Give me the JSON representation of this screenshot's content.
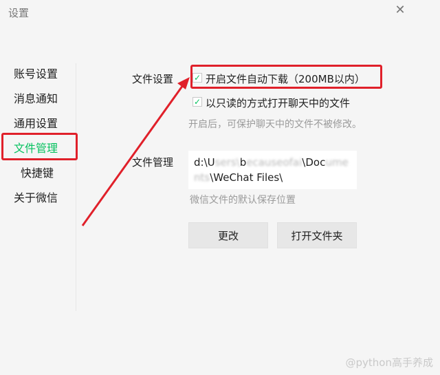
{
  "window": {
    "title": "设置",
    "close_glyph": "✕"
  },
  "sidebar": {
    "items": [
      {
        "label": "账号设置",
        "active": false
      },
      {
        "label": "消息通知",
        "active": false
      },
      {
        "label": "通用设置",
        "active": false
      },
      {
        "label": "文件管理",
        "active": true
      },
      {
        "label": "快捷键",
        "active": false
      },
      {
        "label": "关于微信",
        "active": false
      }
    ]
  },
  "file_settings": {
    "label": "文件设置",
    "auto_download": {
      "label": "开启文件自动下载（200MB以内）",
      "checked": true
    },
    "read_only": {
      "label": "以只读的方式打开聊天中的文件",
      "checked": true
    },
    "hint": "开启后，可保护聊天中的文件不被修改。"
  },
  "file_management": {
    "label": "文件管理",
    "path_prefix": "d:\\U",
    "path_blur_1": "sers\\",
    "path_mid": "b",
    "path_blur_2": "ecauseof",
    "path_blur_3": "a",
    "path_blur_4": "i",
    "path_blur_5": "\\D",
    "path_line2_start": "oc",
    "path_blur_6": "uments",
    "path_suffix": "\\WeChat Files\\",
    "hint": "微信文件的默认保存位置",
    "change_button": "更改",
    "open_folder_button": "打开文件夹"
  },
  "watermark": "@python高手养成",
  "colors": {
    "accent": "#07c160",
    "highlight": "#e0202a"
  },
  "icons": {
    "check": "check-icon",
    "close": "close-icon"
  }
}
